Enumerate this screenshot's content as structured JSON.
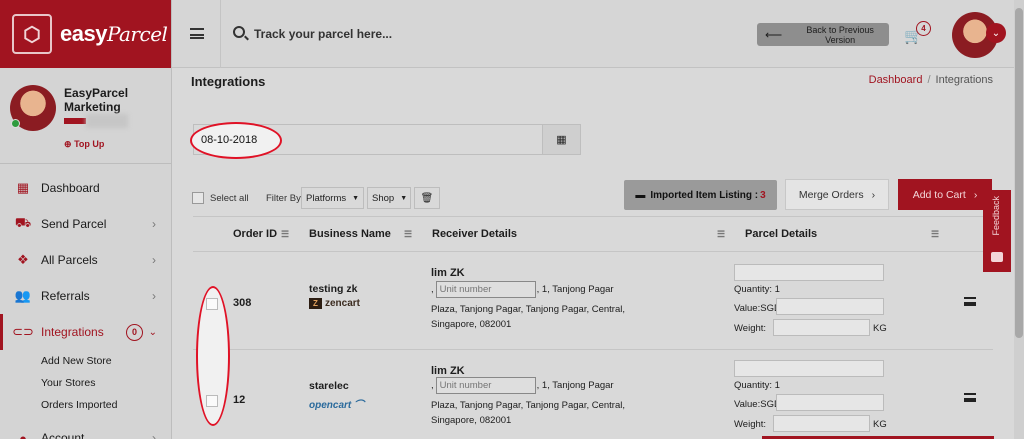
{
  "brand": {
    "logo_text": "easy",
    "logo_text_2": "Parcel"
  },
  "user": {
    "name": "EasyParcel Marketing",
    "topup_label": "Top Up"
  },
  "sidebar": {
    "items": [
      {
        "label": "Dashboard",
        "icon": "dashboard-icon"
      },
      {
        "label": "Send Parcel",
        "icon": "truck-icon"
      },
      {
        "label": "All Parcels",
        "icon": "boxes-icon"
      },
      {
        "label": "Referrals",
        "icon": "users-icon"
      },
      {
        "label": "Integrations",
        "icon": "link-icon",
        "badge": "0"
      },
      {
        "label": "Account",
        "icon": "user-icon"
      }
    ],
    "subitems": [
      "Add New Store",
      "Your Stores",
      "Orders Imported"
    ]
  },
  "topbar": {
    "search_placeholder": "Track your parcel here...",
    "back_label": "Back to Previous Version",
    "cart_count": "4"
  },
  "page": {
    "title": "Integrations",
    "breadcrumb": {
      "home": "Dashboard",
      "current": "Integrations"
    },
    "date_value": "08-10-2018"
  },
  "toolbar": {
    "select_all": "Select all",
    "filter_by": "Filter By:",
    "platforms": "Platforms",
    "shop": "Shop",
    "imported_label": "Imported Item Listing :",
    "imported_count": "3",
    "merge_label": "Merge Orders",
    "add_cart_label": "Add to Cart"
  },
  "table": {
    "headers": [
      "Order ID",
      "Business Name",
      "Receiver Details",
      "Parcel Details"
    ],
    "rows": [
      {
        "order_id": "308",
        "business": "testing zk",
        "platform": "zencart",
        "receiver_name": "lim ZK",
        "unit_placeholder": "Unit number",
        "addr_1": ", 1, Tanjong Pagar",
        "addr_2": "Plaza, Tanjong Pagar, Tanjong Pagar, Central,",
        "addr_3": "Singapore, 082001",
        "quantity": "Quantity: 1",
        "value": "Value:SGD",
        "weight": "Weight:",
        "unit": "KG"
      },
      {
        "order_id": "12",
        "business": "starelec",
        "platform": "opencart",
        "receiver_name": "lim ZK",
        "unit_placeholder": "Unit number",
        "addr_1": ", 1, Tanjong Pagar",
        "addr_2": "Plaza, Tanjong Pagar, Tanjong Pagar, Central,",
        "addr_3": "Singapore, 082001",
        "quantity": "Quantity: 1",
        "value": "Value:SGD",
        "weight": "Weight:",
        "unit": "KG"
      }
    ]
  },
  "feedback_label": "Feedback",
  "colors": {
    "brand": "#a11420",
    "highlight": "#e01226"
  }
}
